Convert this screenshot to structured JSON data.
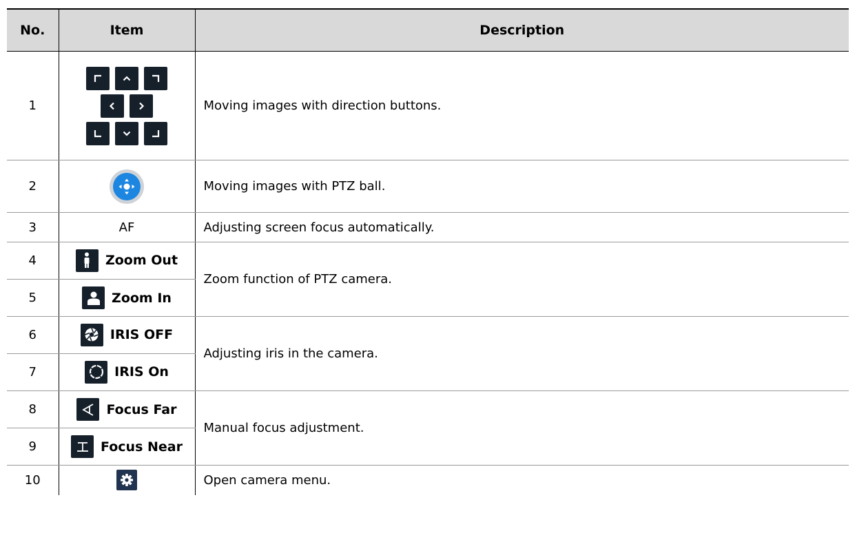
{
  "headers": {
    "no": "No.",
    "item": "Item",
    "description": "Description"
  },
  "rows": [
    {
      "no": "1",
      "description": "Moving images with direction buttons."
    },
    {
      "no": "2",
      "description": "Moving images with PTZ ball."
    },
    {
      "no": "3",
      "item": "AF",
      "description": "Adjusting screen focus automatically."
    },
    {
      "no": "4",
      "item": "Zoom Out",
      "description": "Zoom function of PTZ camera."
    },
    {
      "no": "5",
      "item": "Zoom In"
    },
    {
      "no": "6",
      "item": "IRIS OFF",
      "description": "Adjusting iris in the camera."
    },
    {
      "no": "7",
      "item": "IRIS On"
    },
    {
      "no": "8",
      "item": "Focus Far",
      "description": "Manual focus adjustment."
    },
    {
      "no": "9",
      "item": "Focus Near"
    },
    {
      "no": "10",
      "description": "Open camera menu."
    }
  ],
  "icons": {
    "direction_pad": [
      "top-left-arrow-icon",
      "up-arrow-icon",
      "top-right-arrow-icon",
      "left-arrow-icon",
      "right-arrow-icon",
      "bottom-left-arrow-icon",
      "down-arrow-icon",
      "bottom-right-arrow-icon"
    ],
    "row2": "ptz-ball-icon",
    "row4": "person-standing-icon",
    "row5": "person-bust-icon",
    "row6": "iris-closed-icon",
    "row7": "iris-open-icon",
    "row8": "focus-far-icon",
    "row9": "focus-near-icon",
    "row10": "gear-icon"
  },
  "colors": {
    "header_bg": "#d9d9d9",
    "icon_bg": "#16202b",
    "ptz_blue": "#1d86e0",
    "gear_bg": "#20334f"
  }
}
